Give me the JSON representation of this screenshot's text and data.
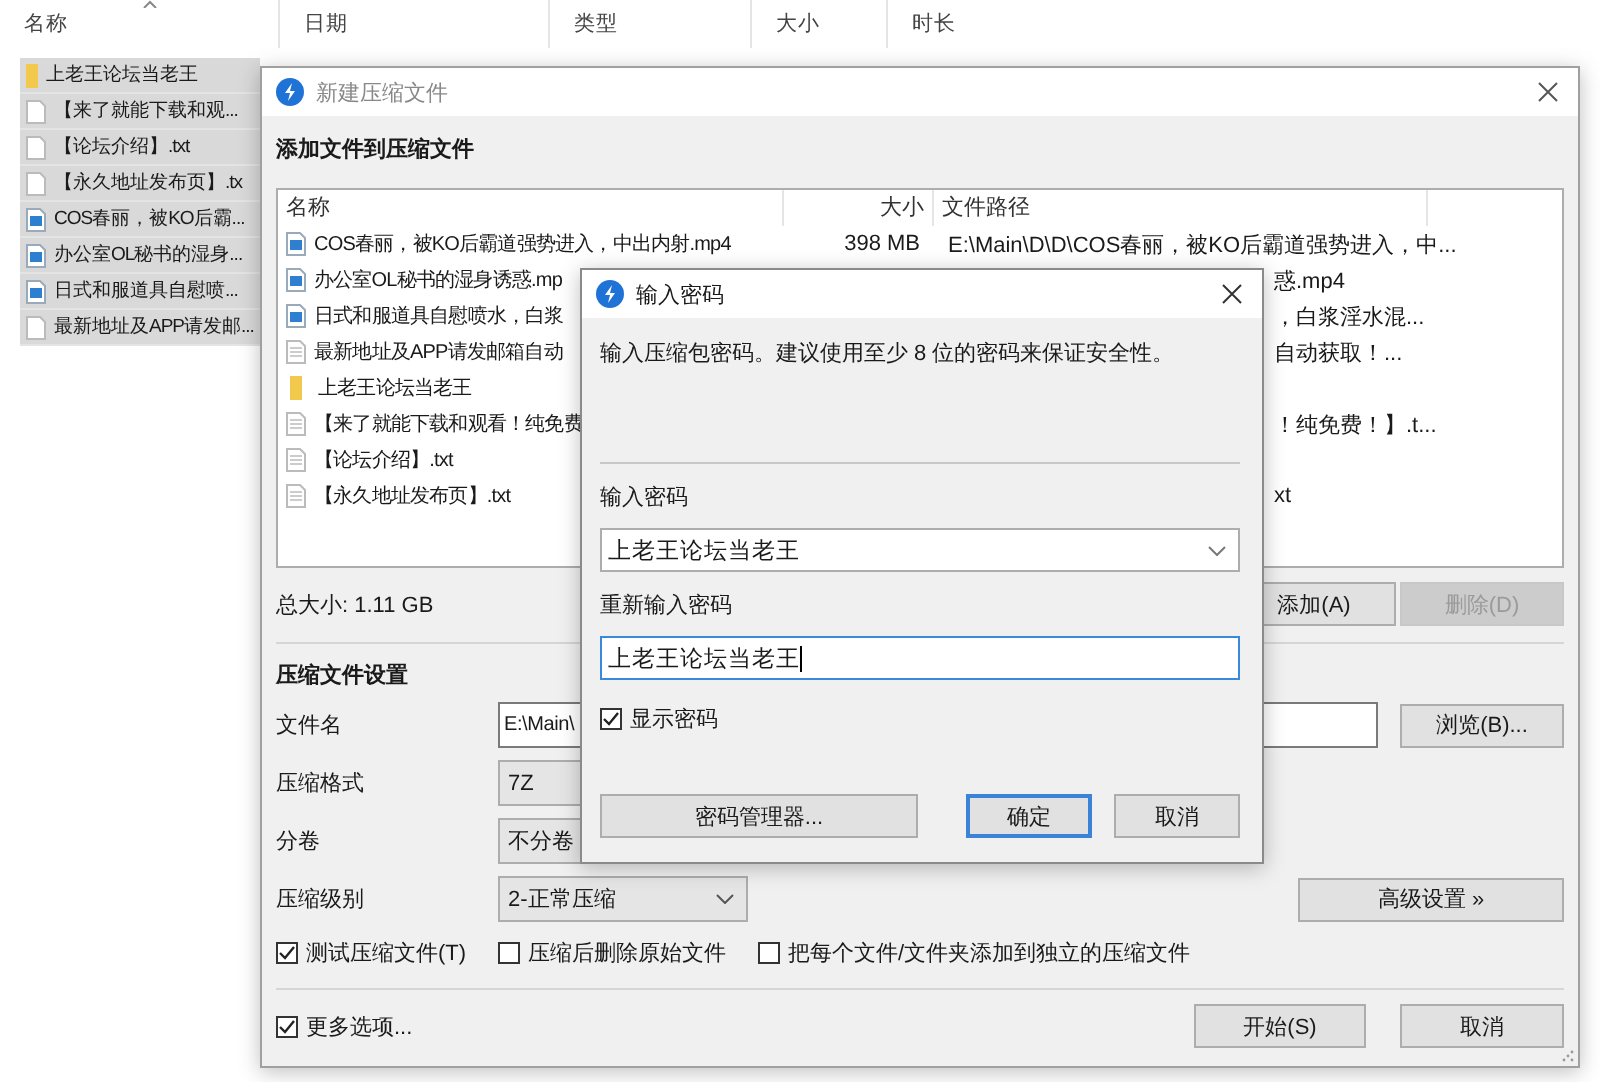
{
  "explorer": {
    "columns": [
      "名称",
      "日期",
      "类型",
      "大小",
      "时长"
    ],
    "rows": [
      {
        "kind": "folder",
        "name": "上老王论坛当老王",
        "selected": true
      },
      {
        "kind": "text",
        "name": "【来了就能下载和观...",
        "selected": true
      },
      {
        "kind": "text",
        "name": "【论坛介绍】.txt",
        "selected": true
      },
      {
        "kind": "text",
        "name": "【永久地址发布页】.tx",
        "selected": true
      },
      {
        "kind": "video",
        "name": "COS春丽，被KO后霸...",
        "selected": true
      },
      {
        "kind": "video",
        "name": "办公室OL秘书的湿身...",
        "selected": true
      },
      {
        "kind": "video",
        "name": "日式和服道具自慰喷...",
        "selected": true
      },
      {
        "kind": "text",
        "name": "最新地址及APP请发邮...",
        "selected": true
      }
    ]
  },
  "compress_window": {
    "title": "新建压缩文件",
    "active": false,
    "section_title": "添加文件到压缩文件",
    "file_list": {
      "columns": [
        "名称",
        "大小",
        "文件路径"
      ],
      "rows": [
        {
          "kind": "video",
          "name": "COS春丽，被KO后霸道强势进入，中出内射.mp4",
          "size": "398 MB",
          "path": "E:\\Main\\D\\D\\COS春丽，被KO后霸道强势进入，中..."
        },
        {
          "kind": "video",
          "name": "办公室OL秘书的湿身诱惑.mp",
          "path_tail": "惑.mp4"
        },
        {
          "kind": "video",
          "name": "日式和服道具自慰喷水，白浆",
          "path_tail": "，白浆淫水混..."
        },
        {
          "kind": "text",
          "name": "最新地址及APP请发邮箱自动",
          "path_tail": "自动获取！..."
        },
        {
          "kind": "folder",
          "name": "上老王论坛当老王"
        },
        {
          "kind": "text",
          "name": "【来了就能下载和观看！纯免费",
          "path_tail": "！纯免费！】.t..."
        },
        {
          "kind": "text",
          "name": "【论坛介绍】.txt"
        },
        {
          "kind": "text",
          "name": "【永久地址发布页】.txt",
          "path_tail": "xt"
        }
      ]
    },
    "total_size": "总大小: 1.11 GB",
    "list_buttons": [
      {
        "label": "添加(A)",
        "disabled": false
      },
      {
        "label": "删除(D)",
        "disabled": true
      }
    ],
    "settings_title": "压缩文件设置",
    "fields": [
      {
        "kind": "text",
        "label": "文件名",
        "value": "E:\\Main\\"
      },
      {
        "kind": "select",
        "label": "压缩格式",
        "value": "7Z"
      },
      {
        "kind": "select",
        "label": "分卷",
        "value": "不分卷"
      },
      {
        "kind": "select",
        "label": "压缩级别",
        "value": "2-正常压缩"
      }
    ],
    "browse_button": "浏览(B)...",
    "advanced_button": "高级设置 »",
    "options": [
      {
        "label": "测试压缩文件(T)",
        "checked": true
      },
      {
        "label": "压缩后删除原始文件",
        "checked": false
      },
      {
        "label": "把每个文件/文件夹添加到独立的压缩文件",
        "checked": false
      }
    ],
    "more_options": {
      "label": "更多选项...",
      "checked": true
    },
    "buttons": [
      "开始(S)",
      "取消"
    ]
  },
  "password_dialog": {
    "title": "输入密码",
    "active": true,
    "description": "输入压缩包密码。建议使用至少 8 位的密码来保证安全性。",
    "password_label": "输入密码",
    "password": "上老王论坛当老王",
    "confirm_label": "重新输入密码",
    "confirm": "上老王论坛当老王",
    "show_password": {
      "label": "显示密码",
      "checked": true
    },
    "buttons": [
      {
        "label": "密码管理器...",
        "default": false
      },
      {
        "label": "确定",
        "default": true
      },
      {
        "label": "取消",
        "default": false
      }
    ]
  }
}
